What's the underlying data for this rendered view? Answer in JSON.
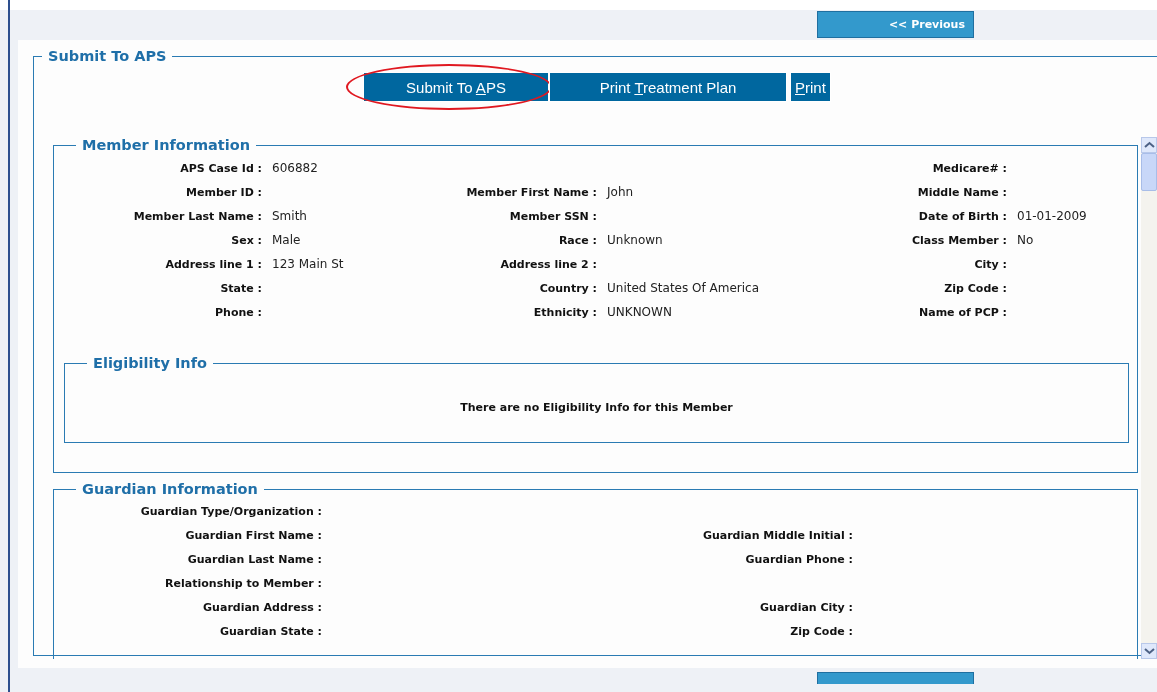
{
  "nav": {
    "previous_label": "<< Previous"
  },
  "submit_section": {
    "title": "Submit To APS",
    "buttons": [
      {
        "label": {
          "before": "Submit To ",
          "access_key": "A",
          "after": "PS"
        },
        "highlighted": true
      },
      {
        "label": {
          "before": "Print ",
          "access_key": "T",
          "after": "reatment Plan"
        },
        "highlighted": false
      },
      {
        "label": {
          "access_key": "P",
          "after": "rint"
        },
        "highlighted": false
      }
    ]
  },
  "member_information": {
    "title": "Member Information",
    "rows": [
      {
        "left": {
          "label": "APS Case Id :",
          "value": "606882"
        },
        "right": {
          "label": "Medicare# :"
        }
      },
      {
        "left": {
          "label": "Member ID :"
        },
        "middle": {
          "label": "Member First Name :",
          "value": "John"
        },
        "right": {
          "label": "Middle Name :"
        }
      },
      {
        "left": {
          "label": "Member Last Name :",
          "value": "Smith"
        },
        "middle": {
          "label": "Member SSN :"
        },
        "right": {
          "label": "Date of Birth :",
          "value": "01-01-2009"
        }
      },
      {
        "left": {
          "label": "Sex :",
          "value": "Male"
        },
        "middle": {
          "label": "Race :",
          "value": "Unknown"
        },
        "right": {
          "label": "Class Member :",
          "value": "No"
        }
      },
      {
        "left": {
          "label": "Address line 1 :",
          "value": "123 Main St"
        },
        "middle": {
          "label": "Address line 2 :"
        },
        "right": {
          "label": "City :"
        }
      },
      {
        "left": {
          "label": "State :"
        },
        "middle": {
          "label": "Country :",
          "value": "United States Of America"
        },
        "right": {
          "label": "Zip Code :"
        }
      },
      {
        "left": {
          "label": "Phone :"
        },
        "middle": {
          "label": "Ethnicity :",
          "value": "UNKNOWN"
        },
        "right": {
          "label": "Name of PCP :"
        }
      }
    ],
    "eligibility": {
      "title": "Eligibility Info",
      "message": "There are no Eligibility Info for this Member"
    }
  },
  "guardian_information": {
    "title": "Guardian Information",
    "rows": [
      {
        "left": {
          "label": "Guardian Type/Organization :"
        }
      },
      {
        "left": {
          "label": "Guardian First Name :"
        },
        "right": {
          "label": "Guardian Middle Initial :"
        }
      },
      {
        "left": {
          "label": "Guardian Last Name :"
        },
        "right": {
          "label": "Guardian Phone :"
        }
      },
      {
        "left": {
          "label": "Relationship to Member :"
        }
      },
      {
        "left": {
          "label": "Guardian Address :"
        },
        "right": {
          "label": "Guardian City :"
        }
      },
      {
        "left": {
          "label": "Guardian State :"
        },
        "right": {
          "label": "Zip Code :"
        }
      }
    ]
  }
}
